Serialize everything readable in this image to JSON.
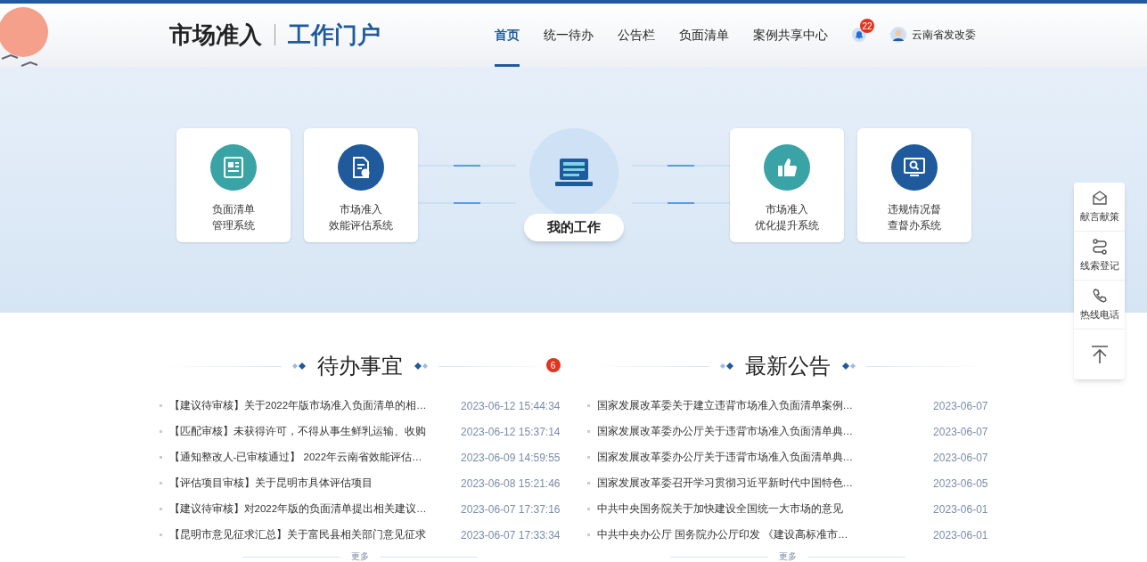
{
  "header": {
    "brand_title": "市场准入",
    "brand_subtitle": "工作门户",
    "nav": [
      {
        "label": "首页",
        "selected": true
      },
      {
        "label": "统一待办",
        "selected": false
      },
      {
        "label": "公告栏",
        "selected": false
      },
      {
        "label": "负面清单",
        "selected": false
      },
      {
        "label": "案例共享中心",
        "selected": false
      }
    ],
    "notification_count": "22",
    "user": "云南省发改委"
  },
  "hero": {
    "systems_left": [
      {
        "kind": "news",
        "color": "#3aa3a6",
        "line1": "负面清单",
        "line2": "管理系统"
      },
      {
        "kind": "doc",
        "color": "#1f5a9c",
        "line1": "市场准入",
        "line2": "效能评估系统"
      }
    ],
    "center_label": "我的工作",
    "systems_right": [
      {
        "kind": "thumb",
        "color": "#3aa3a6",
        "line1": "市场准入",
        "line2": "优化提升系统"
      },
      {
        "kind": "monitor",
        "color": "#1f5a9c",
        "line1": "违规情况督",
        "line2": "查督办系统"
      }
    ]
  },
  "todo": {
    "title": "待办事宜",
    "badge": "6",
    "more": "更多",
    "items": [
      {
        "title": "【建议待审核】关于2022年版市场准入负面清单的相…",
        "time": "2023-06-12 15:44:34"
      },
      {
        "title": "【匹配审核】未获得许可，不得从事生鲜乳运输、收购",
        "time": "2023-06-12 15:37:14"
      },
      {
        "title": "【通知整改人-已审核通过】 2022年云南省效能评估…",
        "time": "2023-06-09 14:59:55"
      },
      {
        "title": "【评估项目审核】关于昆明市具体评估项目",
        "time": "2023-06-08 15:21:46"
      },
      {
        "title": "【建议待审核】对2022年版的负面清单提出相关建议…",
        "time": "2023-06-07 17:37:16"
      },
      {
        "title": "【昆明市意见征求汇总】关于富民县相关部门意见征求",
        "time": "2023-06-07 17:33:34"
      }
    ]
  },
  "notices": {
    "title": "最新公告",
    "more": "更多",
    "items": [
      {
        "title": "国家发展改革委关于建立违背市场准入负面清单案例…",
        "time": "2023-06-07"
      },
      {
        "title": "国家发展改革委办公厅关于违背市场准入负面清单典…",
        "time": "2023-06-07"
      },
      {
        "title": "国家发展改革委办公厅关于违背市场准入负面清单典…",
        "time": "2023-06-07"
      },
      {
        "title": "国家发展改革委召开学习贯彻习近平新时代中国特色…",
        "time": "2023-06-05"
      },
      {
        "title": "中共中央国务院关于加快建设全国统一大市场的意见",
        "time": "2023-06-01"
      },
      {
        "title": "中共中央办公厅 国务院办公厅印发 《建设高标准市…",
        "time": "2023-06-01"
      }
    ]
  },
  "side_tools": [
    {
      "kind": "mail",
      "label": "献言献策"
    },
    {
      "kind": "route",
      "label": "线索登记"
    },
    {
      "kind": "phone",
      "label": "热线电话"
    },
    {
      "kind": "top"
    }
  ]
}
